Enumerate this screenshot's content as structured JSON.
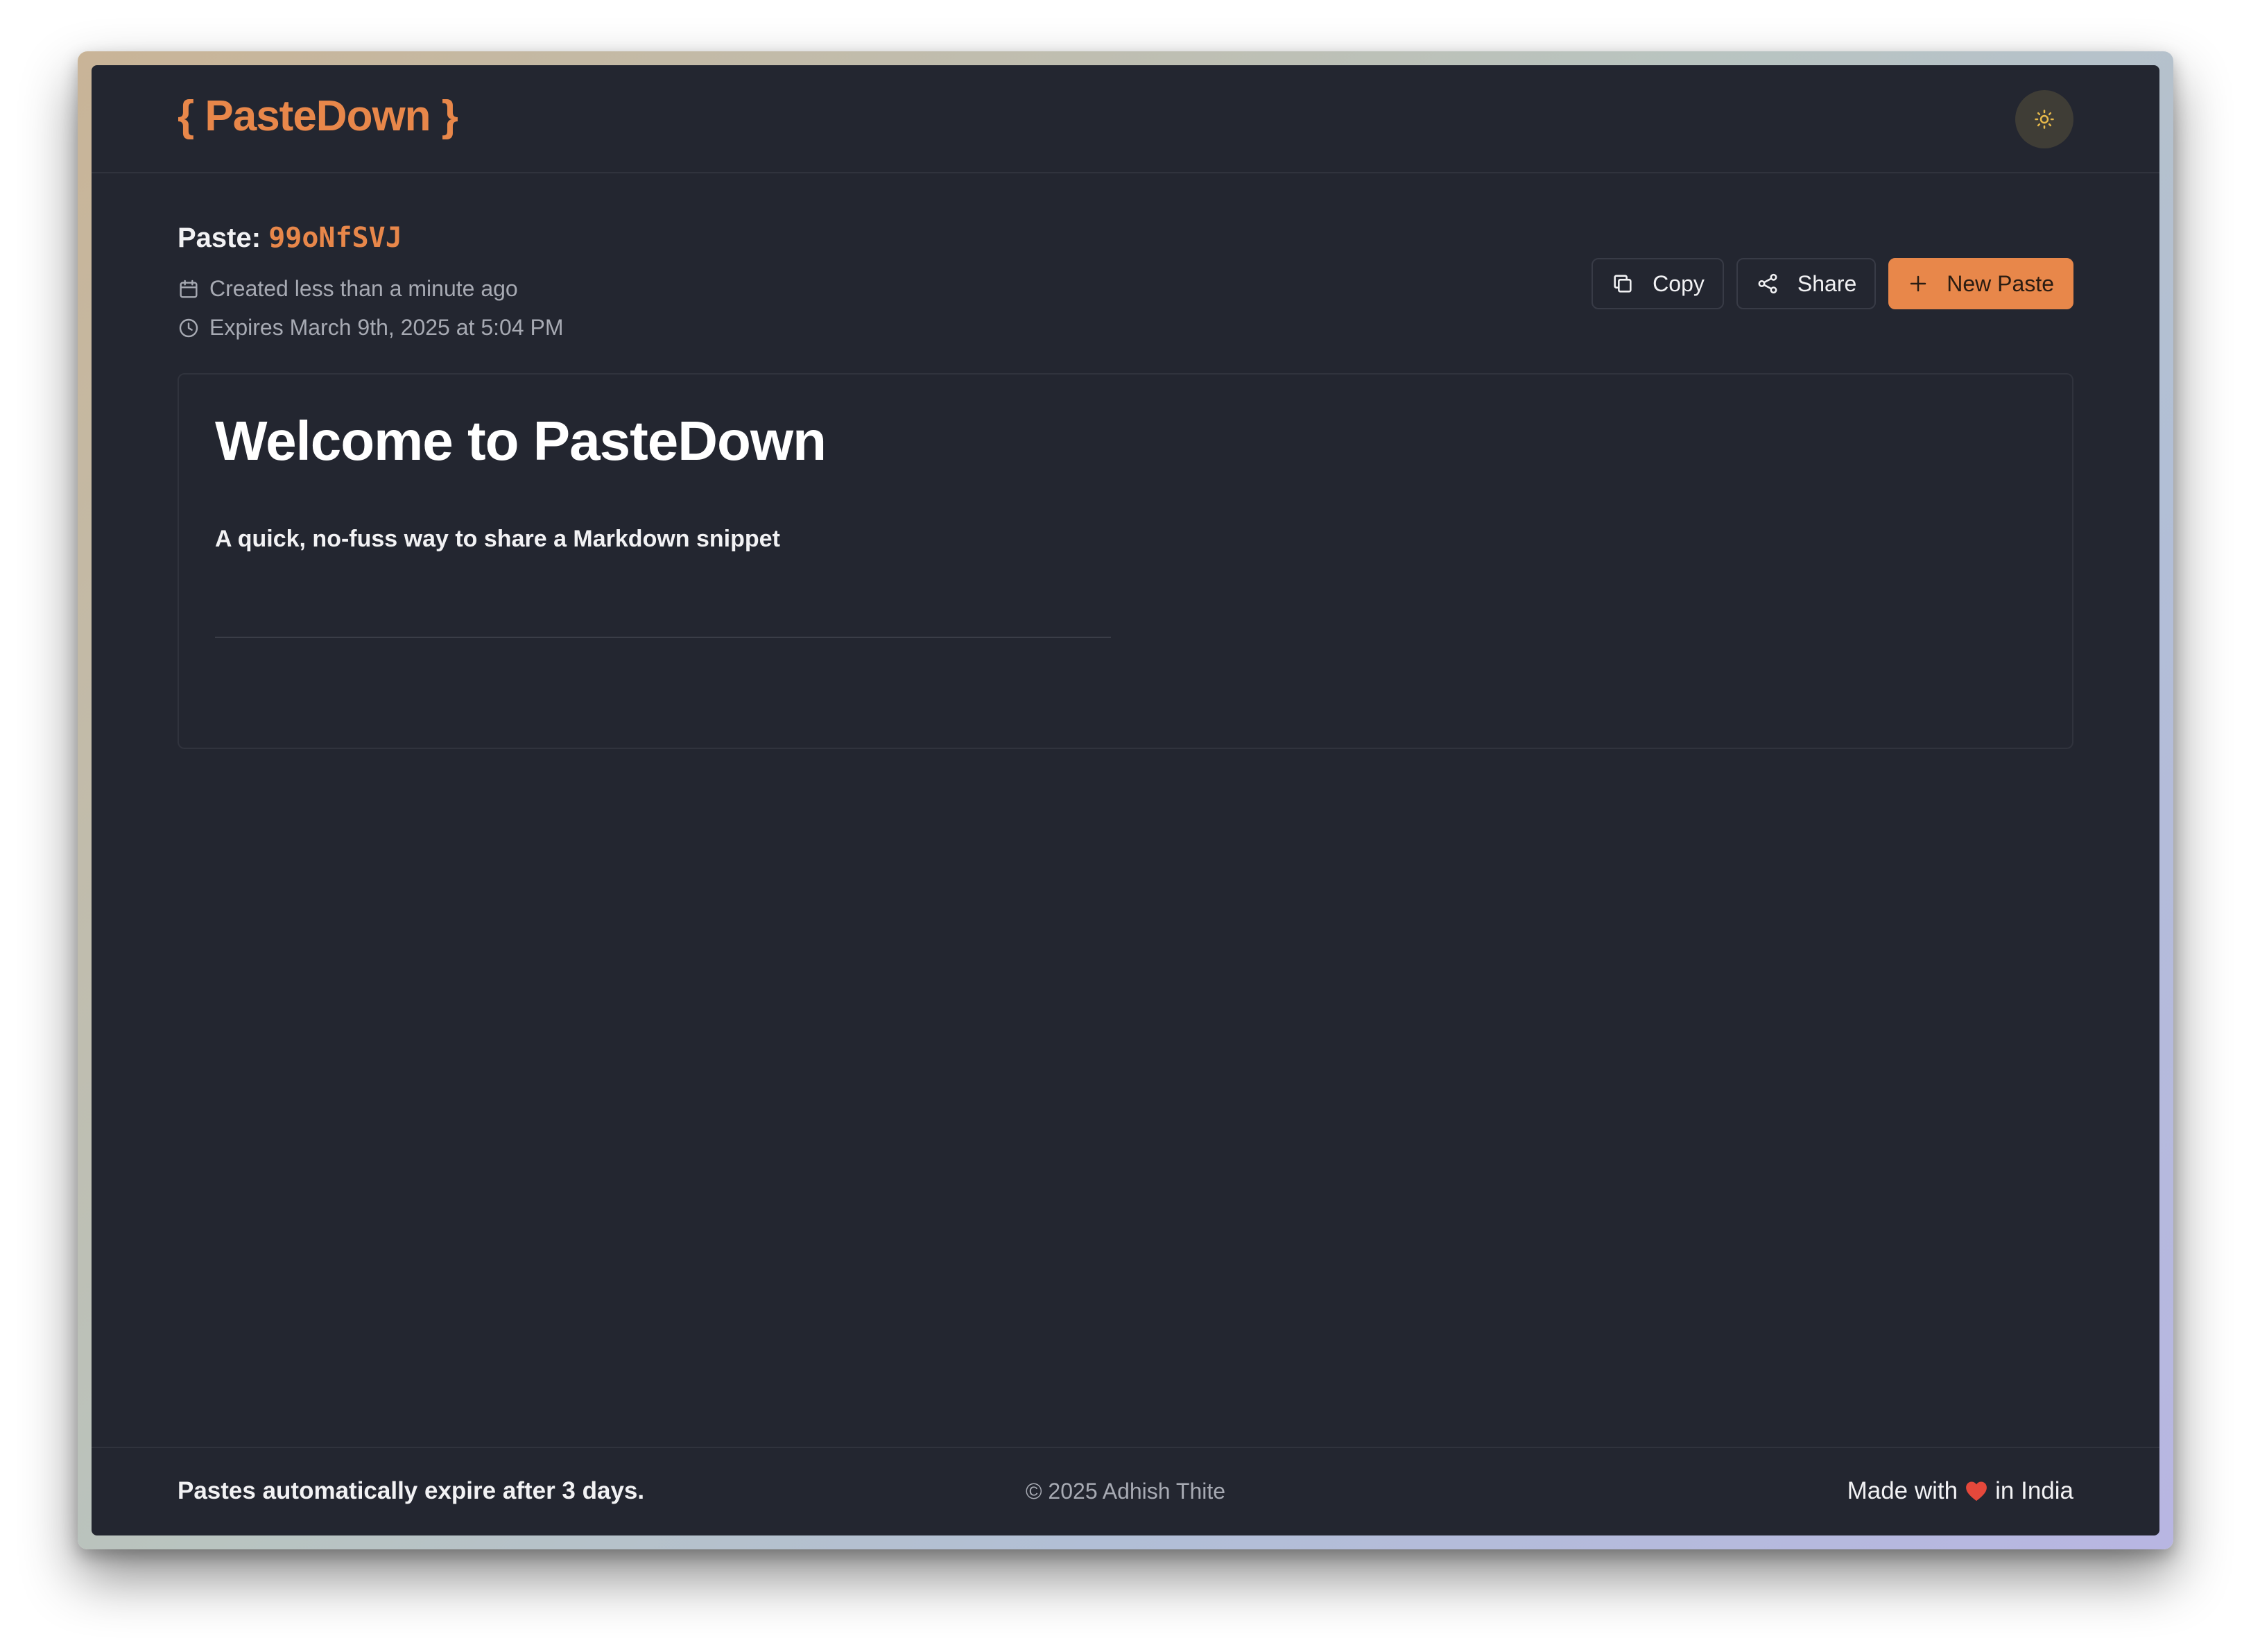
{
  "header": {
    "logo_text": "{ PasteDown }",
    "theme_toggle_icon": "sun-icon"
  },
  "paste": {
    "title_prefix": "Paste:",
    "id": "99oNfSVJ",
    "created": "Created less than a minute ago",
    "expires": "Expires March 9th, 2025 at 5:04 PM"
  },
  "actions": {
    "copy_label": "Copy",
    "share_label": "Share",
    "new_paste_label": "New Paste"
  },
  "content": {
    "heading": "Welcome to PasteDown",
    "paragraph": "A quick, no-fuss way to share a Markdown snippet"
  },
  "footer": {
    "left_text": "Pastes automatically expire after 3 days.",
    "center_text": "© 2025 Adhish Thite",
    "right_prefix": "Made with",
    "right_suffix": "in India",
    "heart_icon": "heart-icon"
  },
  "colors": {
    "accent": "#e8874a",
    "background": "#232630",
    "border": "#30333d",
    "muted_text": "#a7aab3"
  }
}
